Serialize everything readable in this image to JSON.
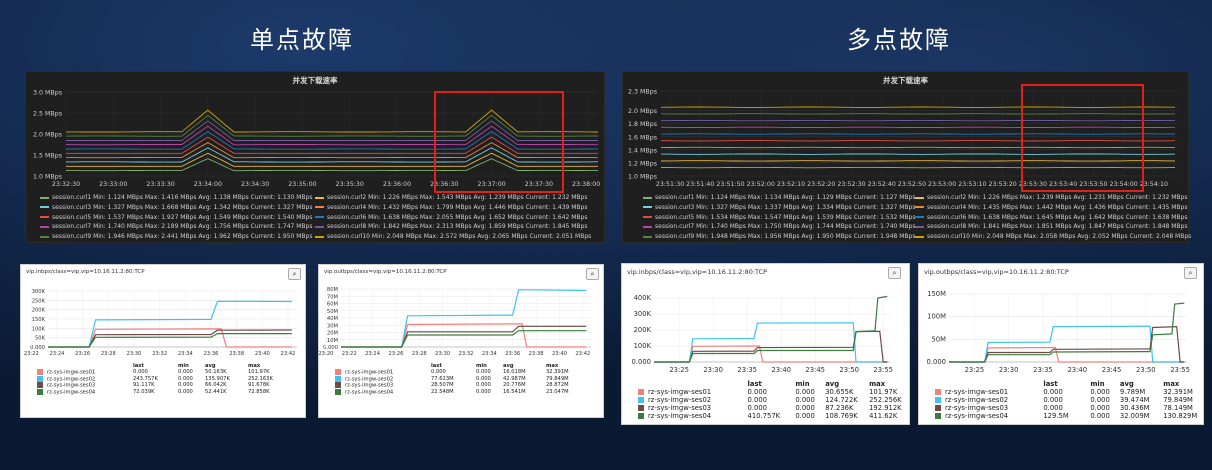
{
  "headings": {
    "single": "单点故障",
    "multi": "多点故障"
  },
  "colors": {
    "grafana": [
      "#7eb26d",
      "#eab839",
      "#6ed0e0",
      "#ef843c",
      "#e24d42",
      "#1f78c1",
      "#ba43a9",
      "#705da0",
      "#508642",
      "#cca300"
    ],
    "zabbix": [
      "#f2817a",
      "#3fc3f0",
      "#6e4a49",
      "#3a7d3f"
    ],
    "highlight": "#e0201a"
  },
  "chart_data": [
    {
      "id": "g1",
      "type": "line",
      "title": "并发下载速率",
      "ylabels": [
        "1.0 MBps",
        "1.5 MBps",
        "2.0 MBps",
        "2.5 MBps",
        "3.0 MBps"
      ],
      "ylim": [
        1.0,
        3.0
      ],
      "yticks": [
        1.0,
        1.5,
        2.0,
        2.5,
        3.0
      ],
      "xlabels": [
        "23:32:30",
        "23:33:00",
        "23:33:30",
        "23:34:00",
        "23:34:30",
        "23:35:00",
        "23:35:30",
        "23:36:00",
        "23:36:30",
        "23:37:00",
        "23:37:30",
        "23:38:00"
      ],
      "xlim": [
        0,
        11.25
      ],
      "legend": [
        {
          "name": "session.curl1",
          "text": "Min: 1.124 MBps  Max: 1.416 MBps  Avg: 1.138 MBps  Current: 1.130 MBps"
        },
        {
          "name": "session.curl2",
          "text": "Min: 1.226 MBps  Max: 1.543 MBps  Avg: 1.239 MBps  Current: 1.232 MBps"
        },
        {
          "name": "session.curl3",
          "text": "Min: 1.327 MBps  Max: 1.668 MBps  Avg: 1.342 MBps  Current: 1.327 MBps"
        },
        {
          "name": "session.curl4",
          "text": "Min: 1.432 MBps  Max: 1.799 MBps  Avg: 1.446 MBps  Current: 1.439 MBps"
        },
        {
          "name": "session.curl5",
          "text": "Min: 1.537 MBps  Max: 1.927 MBps  Avg: 1.549 MBps  Current: 1.540 MBps"
        },
        {
          "name": "session.curl6",
          "text": "Min: 1.638 MBps  Max: 2.055 MBps  Avg: 1.652 MBps  Current: 1.642 MBps"
        },
        {
          "name": "session.curl7",
          "text": "Min: 1.740 MBps  Max: 2.189 MBps  Avg: 1.756 MBps  Current: 1.747 MBps"
        },
        {
          "name": "session.curl8",
          "text": "Min: 1.842 MBps  Max: 2.313 MBps  Avg: 1.859 MBps  Current: 1.845 MBps"
        },
        {
          "name": "session.curl9",
          "text": "Min: 1.946 MBps  Max: 2.441 MBps  Avg: 1.962 MBps  Current: 1.950 MBps"
        },
        {
          "name": "session.curl10",
          "text": "Min: 2.048 MBps  Max: 2.572 MBps  Avg: 2.065 MBps  Current: 2.051 MBps"
        }
      ],
      "series": [
        {
          "name": "session.curl1",
          "base": 1.13,
          "peak": 1.416
        },
        {
          "name": "session.curl2",
          "base": 1.232,
          "peak": 1.543
        },
        {
          "name": "session.curl3",
          "base": 1.335,
          "peak": 1.668
        },
        {
          "name": "session.curl4",
          "base": 1.439,
          "peak": 1.799
        },
        {
          "name": "session.curl5",
          "base": 1.54,
          "peak": 1.927
        },
        {
          "name": "session.curl6",
          "base": 1.642,
          "peak": 2.055
        },
        {
          "name": "session.curl7",
          "base": 1.747,
          "peak": 2.189
        },
        {
          "name": "session.curl8",
          "base": 1.845,
          "peak": 2.313
        },
        {
          "name": "session.curl9",
          "base": 1.95,
          "peak": 2.441
        },
        {
          "name": "session.curl10",
          "base": 2.051,
          "peak": 2.572
        }
      ],
      "spikes_at": [
        "23:34:00",
        "23:37:00"
      ]
    },
    {
      "id": "g2",
      "type": "line",
      "title": "并发下载速率",
      "ylabels": [
        "1.0 MBps",
        "1.2 MBps",
        "1.4 MBps",
        "1.6 MBps",
        "1.8 MBps",
        "2.0 MBps",
        "2.3 MBps"
      ],
      "ylim": [
        1.0,
        2.3
      ],
      "yticks": [
        1.0,
        1.2,
        1.4,
        1.6,
        1.8,
        2.0,
        2.3
      ],
      "xlabels": [
        "23:51:30",
        "23:51:40",
        "23:51:50",
        "23:52:00",
        "23:52:10",
        "23:52:20",
        "23:52:30",
        "23:52:40",
        "23:52:50",
        "23:53:00",
        "23:53:10",
        "23:53:20",
        "23:53:30",
        "23:53:40",
        "23:53:50",
        "23:54:00",
        "23:54:10"
      ],
      "xlim": [
        -0.3,
        16.8
      ],
      "legend": [
        {
          "name": "session.curl1",
          "text": "Min: 1.124 MBps  Max: 1.134 MBps  Avg: 1.129 MBps  Current: 1.127 MBps"
        },
        {
          "name": "session.curl2",
          "text": "Min: 1.226 MBps  Max: 1.239 MBps  Avg: 1.231 MBps  Current: 1.232 MBps"
        },
        {
          "name": "session.curl3",
          "text": "Min: 1.327 MBps  Max: 1.337 MBps  Avg: 1.334 MBps  Current: 1.327 MBps"
        },
        {
          "name": "session.curl4",
          "text": "Min: 1.435 MBps  Max: 1.442 MBps  Avg: 1.436 MBps  Current: 1.435 MBps"
        },
        {
          "name": "session.curl5",
          "text": "Min: 1.534 MBps  Max: 1.547 MBps  Avg: 1.539 MBps  Current: 1.532 MBps"
        },
        {
          "name": "session.curl6",
          "text": "Min: 1.638 MBps  Max: 1.645 MBps  Avg: 1.642 MBps  Current: 1.638 MBps"
        },
        {
          "name": "session.curl7",
          "text": "Min: 1.740 MBps  Max: 1.750 MBps  Avg: 1.744 MBps  Current: 1.740 MBps"
        },
        {
          "name": "session.curl8",
          "text": "Min: 1.841 MBps  Max: 1.851 MBps  Avg: 1.847 MBps  Current: 1.848 MBps"
        },
        {
          "name": "session.curl9",
          "text": "Min: 1.948 MBps  Max: 1.956 MBps  Avg: 1.950 MBps  Current: 1.948 MBps"
        },
        {
          "name": "session.curl10",
          "text": "Min: 2.048 MBps  Max: 2.058 MBps  Avg: 2.052 MBps  Current: 2.048 MBps"
        }
      ],
      "series": [
        {
          "name": "session.curl1",
          "base": 1.129
        },
        {
          "name": "session.curl2",
          "base": 1.231
        },
        {
          "name": "session.curl3",
          "base": 1.334
        },
        {
          "name": "session.curl4",
          "base": 1.436
        },
        {
          "name": "session.curl5",
          "base": 1.539
        },
        {
          "name": "session.curl6",
          "base": 1.642
        },
        {
          "name": "session.curl7",
          "base": 1.744
        },
        {
          "name": "session.curl8",
          "base": 1.847
        },
        {
          "name": "session.curl9",
          "base": 1.95
        },
        {
          "name": "session.curl10",
          "base": 2.052
        }
      ]
    },
    {
      "id": "z1",
      "type": "line",
      "title": "vip.inbps/class=vip,vip=10.16.11.2:80:TCP",
      "ylabels": [
        "0.000",
        "50K",
        "100K",
        "150K",
        "200K",
        "250K",
        "300K"
      ],
      "ylim": [
        0,
        300
      ],
      "yticks": [
        0,
        50,
        100,
        150,
        200,
        250,
        300
      ],
      "xlabels": [
        "23:22",
        "23:24",
        "23:26",
        "23:28",
        "23:30",
        "23:32",
        "23:34",
        "23:36",
        "23:38",
        "23:40",
        "23:42"
      ],
      "xlim": [
        23.3,
        42.7
      ],
      "columns": [
        "last",
        "min",
        "avg",
        "max"
      ],
      "rows": [
        {
          "name": "rz-sys-imgw-ses01",
          "last": "0.000",
          "min": "0.000",
          "avg": "50.163K",
          "max": "101.97K"
        },
        {
          "name": "rz-sys-imgw-ses02",
          "last": "243.757K",
          "min": "0.000",
          "avg": "135.907K",
          "max": "252.163K"
        },
        {
          "name": "rz-sys-imgw-ses03",
          "last": "91.117K",
          "min": "0.000",
          "avg": "66.042K",
          "max": "91.678K"
        },
        {
          "name": "rz-sys-imgw-ses04",
          "last": "72.039K",
          "min": "0.000",
          "avg": "52.441K",
          "max": "72.858K"
        }
      ],
      "series": [
        {
          "name": "rz-sys-imgw-ses01",
          "x": [
            23.3,
            26.5,
            27.0,
            36.8,
            37.2,
            42.3
          ],
          "y": [
            0,
            0,
            95,
            97,
            0,
            0
          ]
        },
        {
          "name": "rz-sys-imgw-ses02",
          "x": [
            23.3,
            26.5,
            27.0,
            36.0,
            36.5,
            42.3
          ],
          "y": [
            0,
            0,
            145,
            148,
            245,
            244
          ]
        },
        {
          "name": "rz-sys-imgw-ses03",
          "x": [
            23.3,
            26.5,
            27.0,
            36.0,
            36.5,
            42.3
          ],
          "y": [
            0,
            0,
            66,
            67,
            90,
            91
          ]
        },
        {
          "name": "rz-sys-imgw-ses04",
          "x": [
            23.3,
            26.5,
            27.0,
            36.0,
            36.5,
            42.3
          ],
          "y": [
            0,
            0,
            52,
            53,
            72,
            72
          ]
        }
      ]
    },
    {
      "id": "z2",
      "type": "line",
      "title": "vip.outbps/class=vip,vip=10.16.11.2:80:TCP",
      "ylabels": [
        "0.000",
        "10M",
        "20M",
        "30M",
        "40M",
        "50M",
        "60M",
        "70M",
        "80M"
      ],
      "ylim": [
        0,
        80
      ],
      "yticks": [
        0,
        10,
        20,
        30,
        40,
        50,
        60,
        70,
        80
      ],
      "xlabels": [
        "23:20",
        "23:22",
        "23:24",
        "23:26",
        "23:28",
        "23:30",
        "23:32",
        "23:34",
        "23:36",
        "23:38",
        "23:40",
        "23:42"
      ],
      "xlim": [
        21.3,
        42.7
      ],
      "columns": [
        "last",
        "min",
        "avg",
        "max"
      ],
      "rows": [
        {
          "name": "rz-sys-imgw-ses01",
          "last": "0.000",
          "min": "0.000",
          "avg": "16.018M",
          "max": "32.391M"
        },
        {
          "name": "rz-sys-imgw-ses02",
          "last": "77.623M",
          "min": "0.000",
          "avg": "42.987M",
          "max": "79.849M"
        },
        {
          "name": "rz-sys-imgw-ses03",
          "last": "28.507M",
          "min": "0.000",
          "avg": "20.776M",
          "max": "28.872M"
        },
        {
          "name": "rz-sys-imgw-ses04",
          "last": "22.548M",
          "min": "0.000",
          "avg": "16.541M",
          "max": "23.047M"
        }
      ],
      "series": [
        {
          "name": "rz-sys-imgw-ses01",
          "x": [
            21.3,
            26.5,
            27.0,
            36.8,
            37.2,
            42.3
          ],
          "y": [
            0,
            0,
            31,
            32,
            0,
            0
          ]
        },
        {
          "name": "rz-sys-imgw-ses02",
          "x": [
            21.3,
            26.5,
            27.0,
            36.0,
            36.5,
            42.3
          ],
          "y": [
            0,
            0,
            43,
            44,
            79,
            78
          ]
        },
        {
          "name": "rz-sys-imgw-ses03",
          "x": [
            21.3,
            26.5,
            27.0,
            36.0,
            36.5,
            42.3
          ],
          "y": [
            0,
            0,
            21,
            21,
            28.5,
            28.5
          ]
        },
        {
          "name": "rz-sys-imgw-ses04",
          "x": [
            21.3,
            26.5,
            27.0,
            36.0,
            36.5,
            42.3
          ],
          "y": [
            0,
            0,
            16.5,
            16.5,
            22.5,
            22.5
          ]
        }
      ]
    },
    {
      "id": "z3",
      "type": "line",
      "title": "vip.inbps/class=vip,vip=10.16.11.2:80:TCP",
      "ylabels": [
        "0.000",
        "100K",
        "200K",
        "300K",
        "400K"
      ],
      "ylim": [
        0,
        400
      ],
      "yticks": [
        0,
        100,
        200,
        300,
        400
      ],
      "xlabels": [
        "23:25",
        "23:30",
        "23:35",
        "23:40",
        "23:45",
        "23:50",
        "23:55"
      ],
      "xlim": [
        21.3,
        56.0
      ],
      "columns": [
        "last",
        "min",
        "avg",
        "max"
      ],
      "rows": [
        {
          "name": "rz-sys-imgw-ses01",
          "last": "0.000",
          "min": "0.000",
          "avg": "30.655K",
          "max": "101.97K"
        },
        {
          "name": "rz-sys-imgw-ses02",
          "last": "0.000",
          "min": "0.000",
          "avg": "124.722K",
          "max": "252.256K"
        },
        {
          "name": "rz-sys-imgw-ses03",
          "last": "0.000",
          "min": "0.000",
          "avg": "87.236K",
          "max": "192.912K"
        },
        {
          "name": "rz-sys-imgw-ses04",
          "last": "410.757K",
          "min": "0.000",
          "avg": "108.769K",
          "max": "411.62K"
        }
      ],
      "series": [
        {
          "name": "rz-sys-imgw-ses01",
          "x": [
            21.3,
            26.5,
            27.0,
            36.8,
            37.3,
            55.6
          ],
          "y": [
            0,
            0,
            98,
            100,
            0,
            0
          ]
        },
        {
          "name": "rz-sys-imgw-ses02",
          "x": [
            21.3,
            26.5,
            27.0,
            36.0,
            36.5,
            50.6,
            51.0,
            55.6
          ],
          "y": [
            0,
            0,
            145,
            147,
            243,
            245,
            0,
            0
          ]
        },
        {
          "name": "rz-sys-imgw-ses03",
          "x": [
            21.3,
            26.5,
            27.0,
            36.0,
            36.5,
            50.6,
            51.0,
            54.5,
            55.0,
            55.6
          ],
          "y": [
            0,
            0,
            67,
            68,
            90,
            92,
            190,
            192,
            0,
            0
          ]
        },
        {
          "name": "rz-sys-imgw-ses04",
          "x": [
            21.3,
            26.5,
            27.0,
            36.0,
            36.5,
            50.6,
            51.0,
            53.8,
            54.2,
            55.6
          ],
          "y": [
            0,
            0,
            53,
            53,
            72,
            72,
            190,
            195,
            400,
            410
          ]
        }
      ]
    },
    {
      "id": "z4",
      "type": "line",
      "title": "vip.outbps/class=vip,vip=10.16.11.2:80:TCP",
      "ylabels": [
        "0.000",
        "50M",
        "100M",
        "150M"
      ],
      "ylim": [
        0,
        150
      ],
      "yticks": [
        0,
        50,
        100,
        150
      ],
      "xlabels": [
        "23:25",
        "23:30",
        "23:35",
        "23:40",
        "23:45",
        "23:50",
        "23:55"
      ],
      "xlim": [
        21.3,
        56.0
      ],
      "columns": [
        "last",
        "min",
        "avg",
        "max"
      ],
      "rows": [
        {
          "name": "rz-sys-imgw-ses01",
          "last": "0.000",
          "min": "0.000",
          "avg": "9.789M",
          "max": "32.391M"
        },
        {
          "name": "rz-sys-imgw-ses02",
          "last": "0.000",
          "min": "0.000",
          "avg": "39.474M",
          "max": "79.849M"
        },
        {
          "name": "rz-sys-imgw-ses03",
          "last": "0.000",
          "min": "0.000",
          "avg": "30.436M",
          "max": "78.149M"
        },
        {
          "name": "rz-sys-imgw-ses04",
          "last": "129.5M",
          "min": "0.000",
          "avg": "32.009M",
          "max": "130.829M"
        }
      ],
      "series": [
        {
          "name": "rz-sys-imgw-ses01",
          "x": [
            21.3,
            26.5,
            27.0,
            36.8,
            37.3,
            55.6
          ],
          "y": [
            0,
            0,
            31,
            32,
            0,
            0
          ]
        },
        {
          "name": "rz-sys-imgw-ses02",
          "x": [
            21.3,
            26.5,
            27.0,
            36.0,
            36.5,
            50.6,
            51.0,
            55.6
          ],
          "y": [
            0,
            0,
            43,
            44,
            78,
            79,
            0,
            0
          ]
        },
        {
          "name": "rz-sys-imgw-ses03",
          "x": [
            21.3,
            26.5,
            27.0,
            36.0,
            36.5,
            50.6,
            51.0,
            54.5,
            55.0,
            55.6
          ],
          "y": [
            0,
            0,
            21,
            21,
            28,
            29,
            76,
            78,
            0,
            0
          ]
        },
        {
          "name": "rz-sys-imgw-ses04",
          "x": [
            21.3,
            26.5,
            27.0,
            36.0,
            36.5,
            50.6,
            51.0,
            53.8,
            54.2,
            55.6
          ],
          "y": [
            0,
            0,
            16,
            16,
            22,
            23,
            60,
            62,
            128,
            130
          ]
        }
      ]
    }
  ]
}
